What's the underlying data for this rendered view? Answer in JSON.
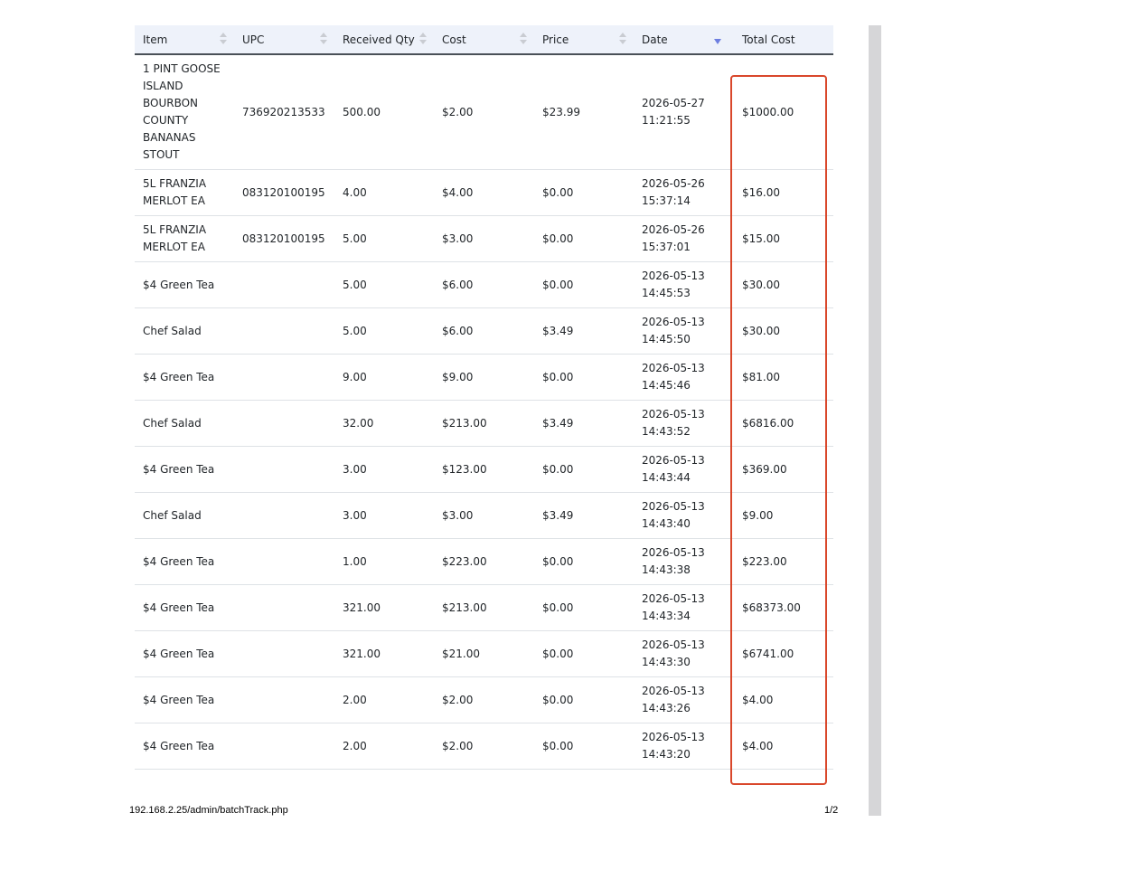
{
  "table": {
    "columns": [
      {
        "label": "Item",
        "sort": "unsorted"
      },
      {
        "label": "UPC",
        "sort": "unsorted"
      },
      {
        "label": "Received Qty",
        "sort": "unsorted"
      },
      {
        "label": "Cost",
        "sort": "unsorted"
      },
      {
        "label": "Price",
        "sort": "unsorted"
      },
      {
        "label": "Date",
        "sort": "descending"
      },
      {
        "label": "Total Cost",
        "sort": "none"
      }
    ],
    "rows": [
      {
        "item": "1 PINT GOOSE ISLAND BOURBON COUNTY BANANAS STOUT",
        "upc": "736920213533",
        "qty": "500.00",
        "cost": "$2.00",
        "price": "$23.99",
        "date": "2026-05-27 11:21:55",
        "total": "$1000.00"
      },
      {
        "item": "5L FRANZIA MERLOT EA",
        "upc": "083120100195",
        "qty": "4.00",
        "cost": "$4.00",
        "price": "$0.00",
        "date": "2026-05-26 15:37:14",
        "total": "$16.00"
      },
      {
        "item": "5L FRANZIA MERLOT EA",
        "upc": "083120100195",
        "qty": "5.00",
        "cost": "$3.00",
        "price": "$0.00",
        "date": "2026-05-26 15:37:01",
        "total": "$15.00"
      },
      {
        "item": "$4 Green Tea",
        "upc": "",
        "qty": "5.00",
        "cost": "$6.00",
        "price": "$0.00",
        "date": "2026-05-13 14:45:53",
        "total": "$30.00"
      },
      {
        "item": "Chef Salad",
        "upc": "",
        "qty": "5.00",
        "cost": "$6.00",
        "price": "$3.49",
        "date": "2026-05-13 14:45:50",
        "total": "$30.00"
      },
      {
        "item": "$4 Green Tea",
        "upc": "",
        "qty": "9.00",
        "cost": "$9.00",
        "price": "$0.00",
        "date": "2026-05-13 14:45:46",
        "total": "$81.00"
      },
      {
        "item": "Chef Salad",
        "upc": "",
        "qty": "32.00",
        "cost": "$213.00",
        "price": "$3.49",
        "date": "2026-05-13 14:43:52",
        "total": "$6816.00"
      },
      {
        "item": "$4 Green Tea",
        "upc": "",
        "qty": "3.00",
        "cost": "$123.00",
        "price": "$0.00",
        "date": "2026-05-13 14:43:44",
        "total": "$369.00"
      },
      {
        "item": "Chef Salad",
        "upc": "",
        "qty": "3.00",
        "cost": "$3.00",
        "price": "$3.49",
        "date": "2026-05-13 14:43:40",
        "total": "$9.00"
      },
      {
        "item": "$4 Green Tea",
        "upc": "",
        "qty": "1.00",
        "cost": "$223.00",
        "price": "$0.00",
        "date": "2026-05-13 14:43:38",
        "total": "$223.00"
      },
      {
        "item": "$4 Green Tea",
        "upc": "",
        "qty": "321.00",
        "cost": "$213.00",
        "price": "$0.00",
        "date": "2026-05-13 14:43:34",
        "total": "$68373.00"
      },
      {
        "item": "$4 Green Tea",
        "upc": "",
        "qty": "321.00",
        "cost": "$21.00",
        "price": "$0.00",
        "date": "2026-05-13 14:43:30",
        "total": "$6741.00"
      },
      {
        "item": "$4 Green Tea",
        "upc": "",
        "qty": "2.00",
        "cost": "$2.00",
        "price": "$0.00",
        "date": "2026-05-13 14:43:26",
        "total": "$4.00"
      },
      {
        "item": "$4 Green Tea",
        "upc": "",
        "qty": "2.00",
        "cost": "$2.00",
        "price": "$0.00",
        "date": "2026-05-13 14:43:20",
        "total": "$4.00"
      }
    ]
  },
  "footer": {
    "url": "192.168.2.25/admin/batchTrack.php",
    "page_indicator": "1/2"
  },
  "colors": {
    "header_bg": "#eef2fa",
    "highlight_box": "#d9472b",
    "sort_active": "#6d7ee0"
  }
}
